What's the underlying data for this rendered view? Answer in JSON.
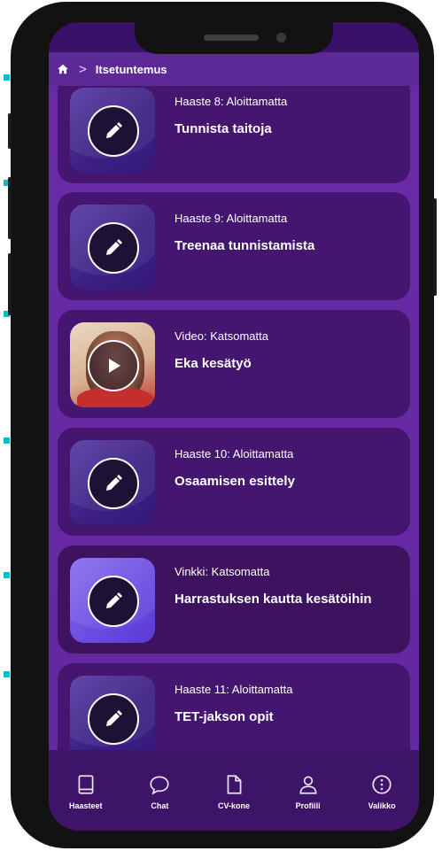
{
  "breadcrumb": {
    "home_icon": "home-icon",
    "separator": ">",
    "current": "Itsetuntemus"
  },
  "cards": [
    {
      "meta": "Haaste 8: Aloittamatta",
      "title": "Tunnista taitoja",
      "icon": "pencil-icon"
    },
    {
      "meta": "Haaste 9: Aloittamatta",
      "title": "Treenaa tunnistamista",
      "icon": "pencil-icon"
    },
    {
      "meta": "Video: Katsomatta",
      "title": "Eka kesätyö",
      "icon": "play-icon"
    },
    {
      "meta": "Haaste 10: Aloittamatta",
      "title": "Osaamisen esittely",
      "icon": "pencil-icon"
    },
    {
      "meta": "Vinkki: Katsomatta",
      "title": "Harrastuksen kautta kesätöihin",
      "icon": "pencil-icon"
    },
    {
      "meta": "Haaste 11: Aloittamatta",
      "title": "TET-jakson opit",
      "icon": "pencil-icon"
    }
  ],
  "nav": [
    {
      "label": "Haasteet",
      "icon": "book-icon"
    },
    {
      "label": "Chat",
      "icon": "chat-bubble-icon"
    },
    {
      "label": "CV-kone",
      "icon": "document-icon"
    },
    {
      "label": "Profiili",
      "icon": "person-icon"
    },
    {
      "label": "Valikko",
      "icon": "info-circle-icon"
    }
  ],
  "colors": {
    "background": "#6a2aa8",
    "card": "#45166f",
    "topbar": "#5d2996",
    "bottombar": "#3e1468",
    "accent_dots": "#14b8c8"
  }
}
